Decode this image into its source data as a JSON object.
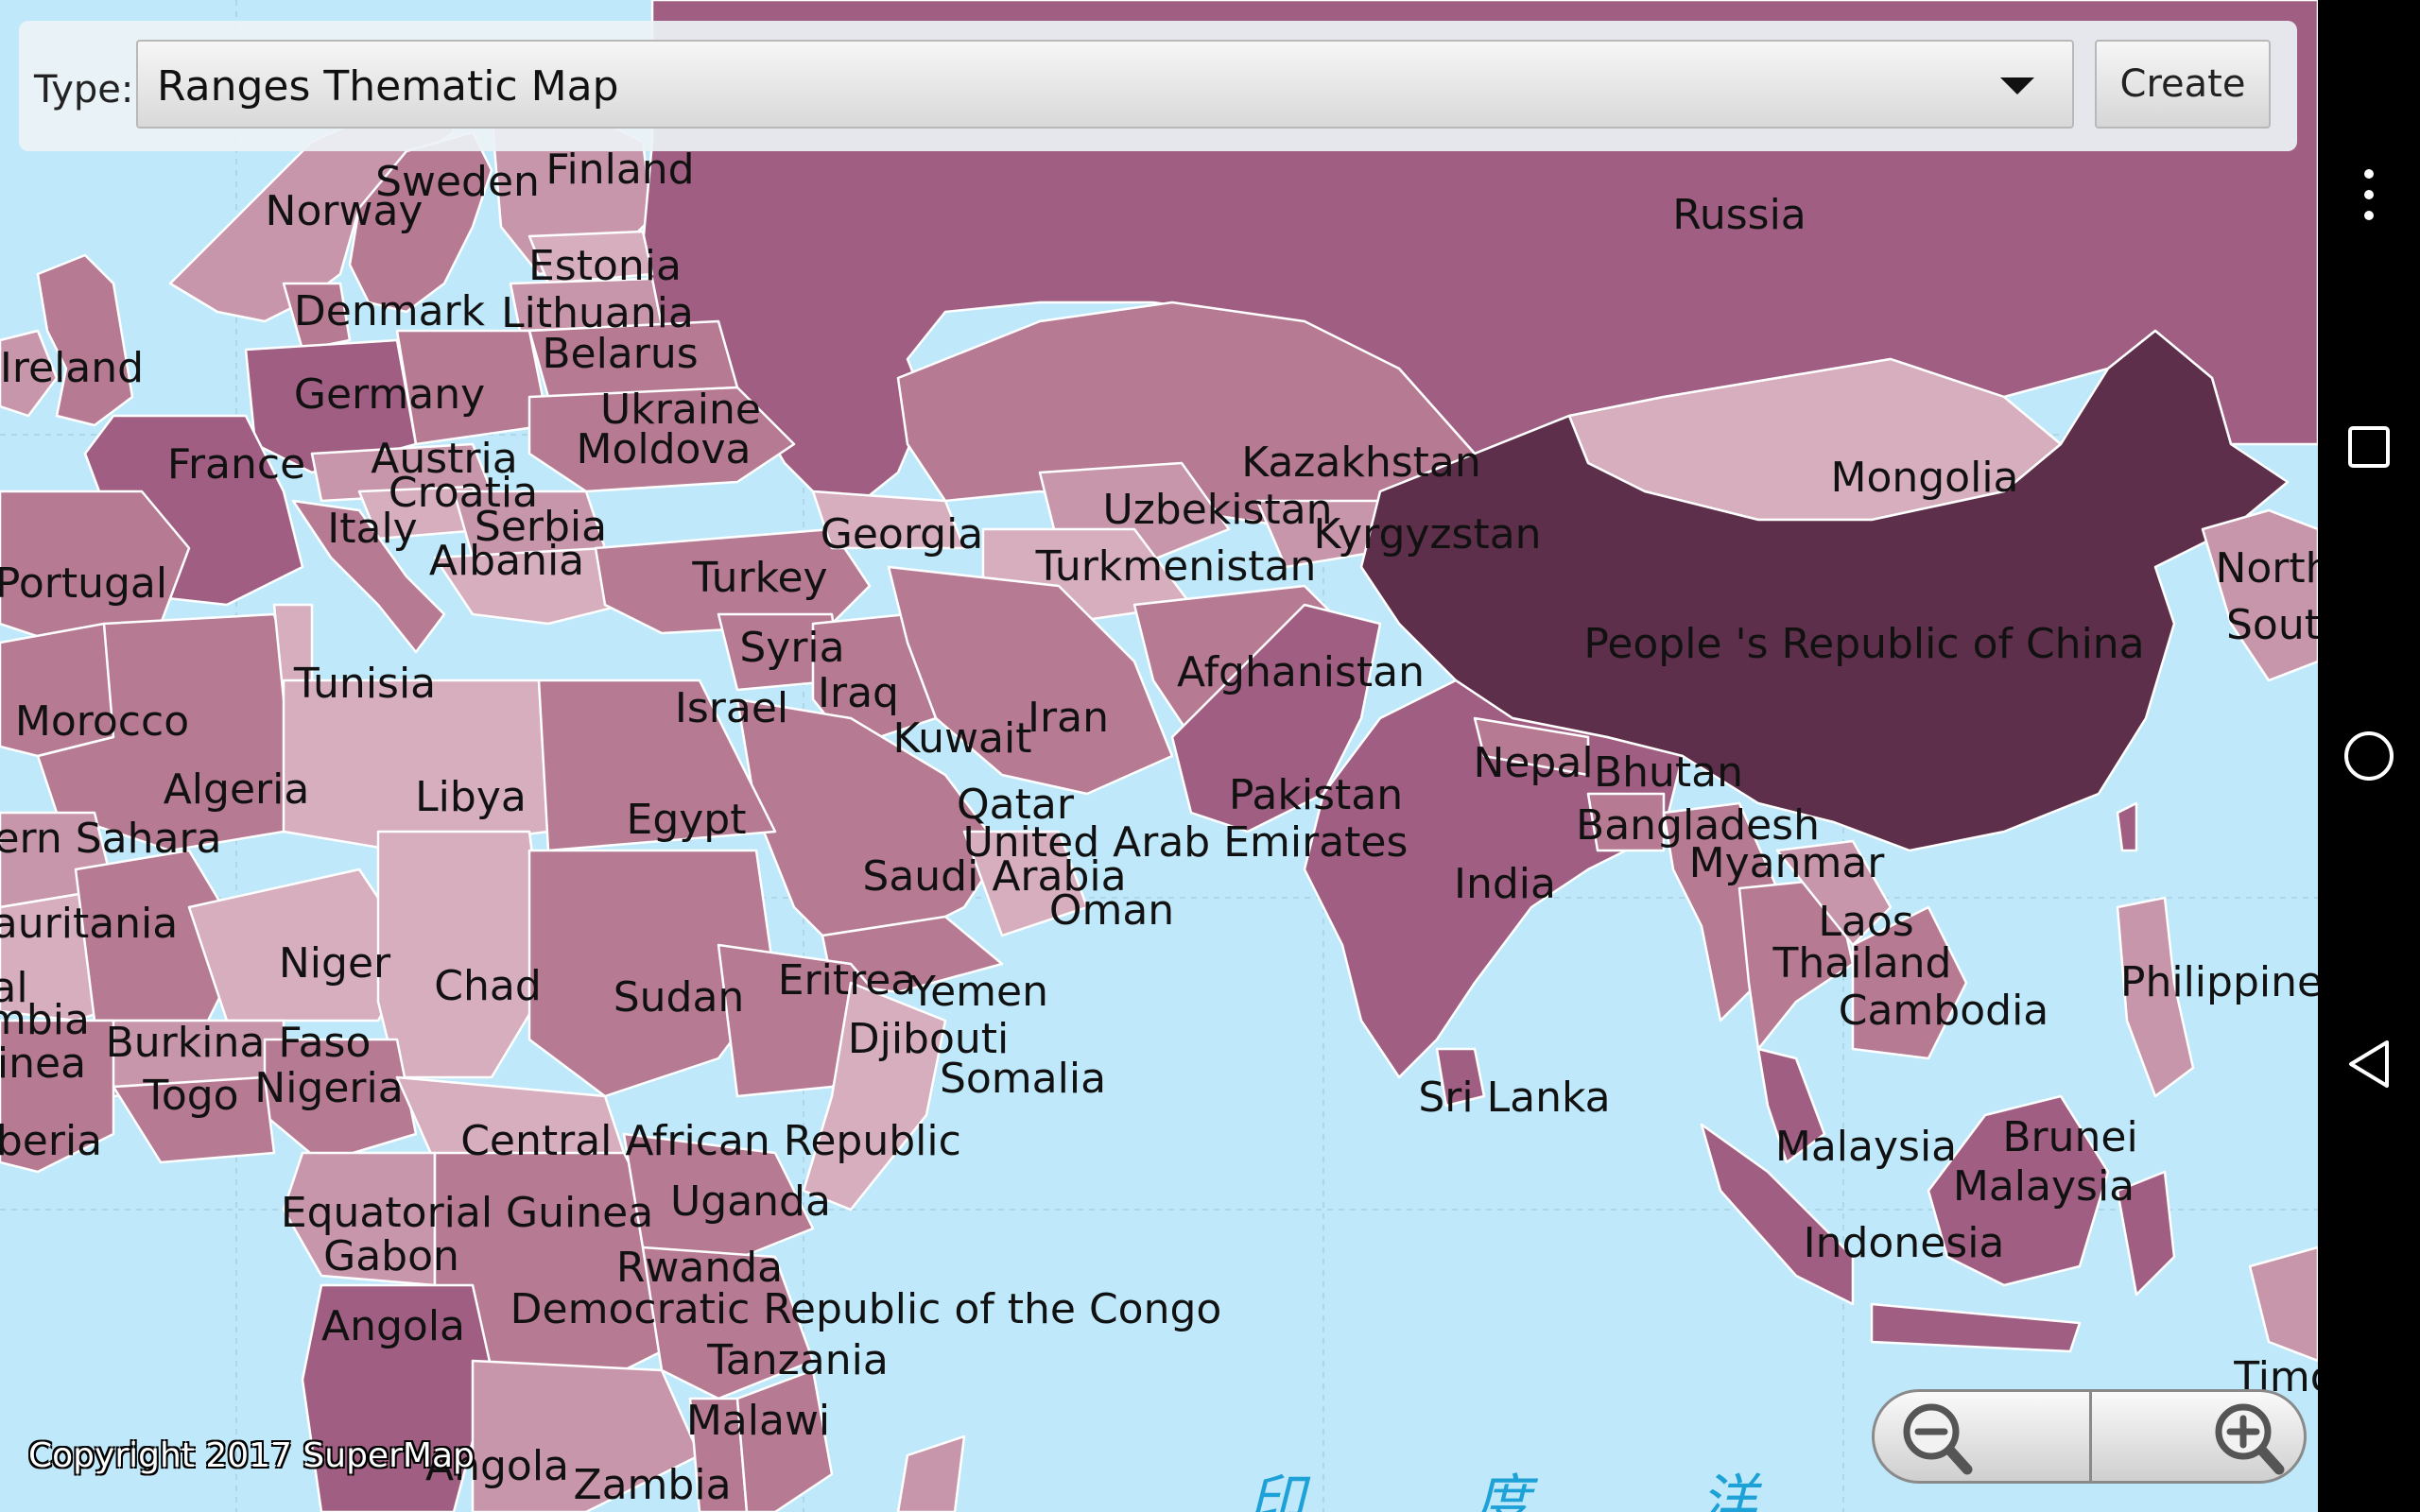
{
  "toolbar": {
    "type_label": "Type:",
    "selected_type": "Ranges Thematic Map",
    "create_label": "Create"
  },
  "map": {
    "copyright": "Copyright 2017 SuperMap",
    "ocean_label": "印 度 洋",
    "colors": {
      "ocean": "#bfe9fb",
      "range_1": "#d6aebe",
      "range_2": "#c896aa",
      "range_3": "#b67a92",
      "range_4": "#a05f82",
      "range_5": "#5e2f4a"
    },
    "labels": [
      {
        "id": "sweden",
        "text": "Sweden"
      },
      {
        "id": "finland",
        "text": "Finland"
      },
      {
        "id": "norway",
        "text": "Norway"
      },
      {
        "id": "russia",
        "text": "Russia"
      },
      {
        "id": "estonia",
        "text": "Estonia"
      },
      {
        "id": "denmark",
        "text": "Denmark"
      },
      {
        "id": "lithuania",
        "text": "Lithuania"
      },
      {
        "id": "ireland",
        "text": "Ireland"
      },
      {
        "id": "belarus",
        "text": "Belarus"
      },
      {
        "id": "germany",
        "text": "Germany"
      },
      {
        "id": "ukraine",
        "text": "Ukraine"
      },
      {
        "id": "moldova",
        "text": "Moldova"
      },
      {
        "id": "france",
        "text": "France"
      },
      {
        "id": "austria",
        "text": "Austria"
      },
      {
        "id": "croatia",
        "text": "Croatia"
      },
      {
        "id": "kazakhstan",
        "text": "Kazakhstan"
      },
      {
        "id": "mongolia",
        "text": "Mongolia"
      },
      {
        "id": "uzbekistan",
        "text": "Uzbekistan"
      },
      {
        "id": "italy",
        "text": "Italy"
      },
      {
        "id": "serbia",
        "text": "Serbia"
      },
      {
        "id": "georgia",
        "text": "Georgia"
      },
      {
        "id": "kyrgyzstan",
        "text": "Kyrgyzstan"
      },
      {
        "id": "albania",
        "text": "Albania"
      },
      {
        "id": "turkmenistan",
        "text": "Turkmenistan"
      },
      {
        "id": "portugal",
        "text": "Portugal"
      },
      {
        "id": "turkey",
        "text": "Turkey"
      },
      {
        "id": "north-korea",
        "text": "North"
      },
      {
        "id": "south-korea",
        "text": "Sout"
      },
      {
        "id": "syria",
        "text": "Syria"
      },
      {
        "id": "china",
        "text": "People 's Republic of China"
      },
      {
        "id": "tunisia",
        "text": "Tunisia"
      },
      {
        "id": "afghanistan",
        "text": "Afghanistan"
      },
      {
        "id": "iraq",
        "text": "Iraq"
      },
      {
        "id": "israel",
        "text": "Israel"
      },
      {
        "id": "morocco",
        "text": "Morocco"
      },
      {
        "id": "iran",
        "text": "Iran"
      },
      {
        "id": "kuwait",
        "text": "Kuwait"
      },
      {
        "id": "nepal",
        "text": "Nepal"
      },
      {
        "id": "bhutan",
        "text": "Bhutan"
      },
      {
        "id": "algeria",
        "text": "Algeria"
      },
      {
        "id": "libya",
        "text": "Libya"
      },
      {
        "id": "pakistan",
        "text": "Pakistan"
      },
      {
        "id": "qatar",
        "text": "Qatar"
      },
      {
        "id": "egypt",
        "text": "Egypt"
      },
      {
        "id": "bangladesh",
        "text": "Bangladesh"
      },
      {
        "id": "western-sahara",
        "text": "ern Sahara"
      },
      {
        "id": "uae",
        "text": "United Arab Emirates"
      },
      {
        "id": "myanmar",
        "text": "Myanmar"
      },
      {
        "id": "india",
        "text": "India"
      },
      {
        "id": "saudi-arabia",
        "text": "Saudi Arabia"
      },
      {
        "id": "oman",
        "text": "Oman"
      },
      {
        "id": "mauritania",
        "text": "auritania"
      },
      {
        "id": "laos",
        "text": "Laos"
      },
      {
        "id": "niger",
        "text": "Niger"
      },
      {
        "id": "thailand",
        "text": "Thailand"
      },
      {
        "id": "eritrea",
        "text": "Eritrea"
      },
      {
        "id": "chad",
        "text": "Chad"
      },
      {
        "id": "philippines",
        "text": "Philippine"
      },
      {
        "id": "yemen",
        "text": "Yemen"
      },
      {
        "id": "sudan",
        "text": "Sudan"
      },
      {
        "id": "mali",
        "text": "al"
      },
      {
        "id": "cambodia",
        "text": "Cambodia"
      },
      {
        "id": "gambia",
        "text": "mbia"
      },
      {
        "id": "djibouti",
        "text": "Djibouti"
      },
      {
        "id": "burkina-faso",
        "text": "Burkina Faso"
      },
      {
        "id": "guinea",
        "text": "inea"
      },
      {
        "id": "somalia",
        "text": "Somalia"
      },
      {
        "id": "nigeria",
        "text": "Nigeria"
      },
      {
        "id": "togo",
        "text": "Togo"
      },
      {
        "id": "sri-lanka",
        "text": "Sri Lanka"
      },
      {
        "id": "brunei",
        "text": "Brunei"
      },
      {
        "id": "liberia",
        "text": "beria"
      },
      {
        "id": "car",
        "text": "Central African Republic"
      },
      {
        "id": "malaysia-west",
        "text": "Malaysia"
      },
      {
        "id": "malaysia-east",
        "text": "Malaysia"
      },
      {
        "id": "uganda",
        "text": "Uganda"
      },
      {
        "id": "equatorial-guinea",
        "text": "Equatorial Guinea"
      },
      {
        "id": "indonesia",
        "text": "Indonesia"
      },
      {
        "id": "gabon",
        "text": "Gabon"
      },
      {
        "id": "rwanda",
        "text": "Rwanda"
      },
      {
        "id": "drc",
        "text": "Democratic Republic of the Congo"
      },
      {
        "id": "angola",
        "text": "Angola"
      },
      {
        "id": "tanzania",
        "text": "Tanzania"
      },
      {
        "id": "timor",
        "text": "Timor"
      },
      {
        "id": "malawi",
        "text": "Malawi"
      },
      {
        "id": "angola-2",
        "text": "Angola"
      },
      {
        "id": "zambia",
        "text": "Zambia"
      }
    ]
  },
  "icons": {
    "zoom_out": "zoom-out-icon",
    "zoom_in": "zoom-in-icon",
    "overflow": "more-vertical-icon",
    "recents": "square-recents-icon",
    "home": "circle-home-icon",
    "back": "triangle-back-icon"
  }
}
